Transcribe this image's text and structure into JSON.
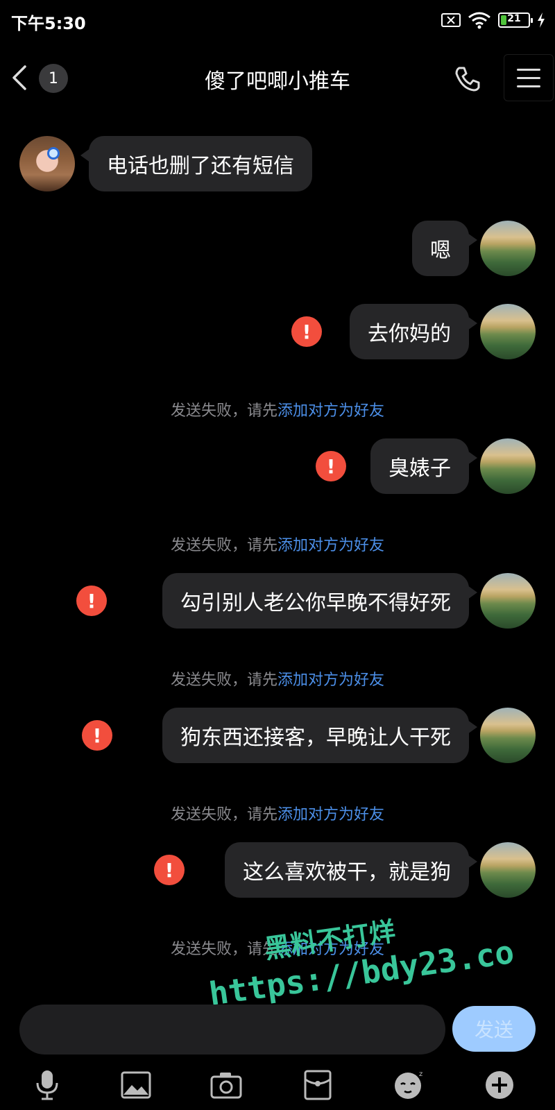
{
  "status_bar": {
    "time": "下午5:30",
    "battery_level": "21",
    "battery_fraction": 0.21
  },
  "header": {
    "title": "傻了吧唧小推车",
    "unread_count": "1"
  },
  "messages": [
    {
      "side": "left",
      "text": "电话也删了还有短信",
      "failed": false
    },
    {
      "side": "right",
      "text": "嗯",
      "failed": false
    },
    {
      "side": "right",
      "text": "去你妈的",
      "failed": true
    },
    {
      "side": "right",
      "text": "臭婊子",
      "failed": true
    },
    {
      "side": "right",
      "text": "勾引别人老公你早晚不得好死",
      "failed": true
    },
    {
      "side": "right",
      "text": "狗东西还接客，早晚让人干死",
      "failed": true
    },
    {
      "side": "right",
      "text": "这么喜欢被干，就是狗",
      "failed": true
    }
  ],
  "fail_notice": {
    "prefix": "发送失败，请先",
    "link": "添加对方为好友"
  },
  "fail_icon_glyph": "!",
  "watermark": {
    "line1": "黑料不打烊",
    "line2": "https://bdy23.co"
  },
  "input": {
    "placeholder": "",
    "value": "",
    "send_label": "发送"
  },
  "toolbar": {
    "items": [
      "microphone-icon",
      "image-icon",
      "camera-icon",
      "red-packet-icon",
      "emoji-icon",
      "plus-icon"
    ]
  },
  "colors": {
    "background": "#000000",
    "bubble": "#262628",
    "fail_red": "#f24e3d",
    "link_blue": "#4c8fe8",
    "send_button": "#9ecbff",
    "watermark": "#39c69a"
  }
}
